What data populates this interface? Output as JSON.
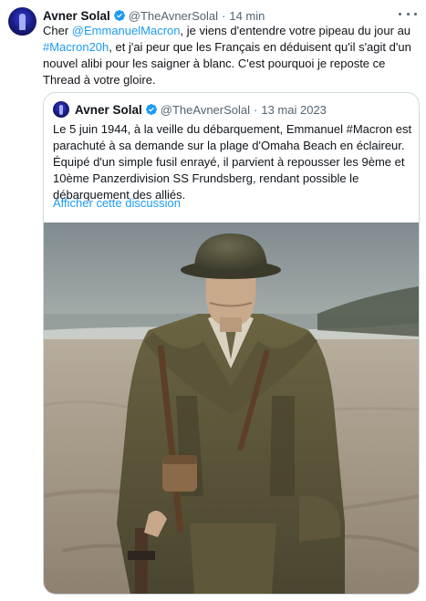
{
  "tweet": {
    "author_name": "Avner Solal",
    "handle": "@TheAvnerSolal",
    "separator": "·",
    "time": "14 min",
    "text_parts": [
      {
        "text": "Cher ",
        "type": "text"
      },
      {
        "text": "@EmmanuelMacron",
        "type": "link"
      },
      {
        "text": ", je viens d'entendre votre pipeau du jour au ",
        "type": "text"
      },
      {
        "text": "#Macron20h",
        "type": "link"
      },
      {
        "text": ", et j'ai peur que les Français en déduisent qu'il s'agit d'un nouvel alibi pour les saigner à blanc. C'est pourquoi je reposte ce Thread à votre gloire.",
        "type": "text"
      }
    ]
  },
  "quoted": {
    "author_name": "Avner Solal",
    "handle": "@TheAvnerSolal",
    "separator": "·",
    "date": "13 mai 2023",
    "text": "Le 5 juin 1944, à la veille du débarquement, Emmanuel #Macron est parachuté à sa demande sur la plage d'Omaha Beach en éclaireur. Équipé d'un simple fusil enrayé, il parvient à repousser les 9ème et 10ème Panzerdivision SS Frundsberg, rendant possible le débarquement des alliés.",
    "show_thread_label": "Afficher cette discussion"
  },
  "colors": {
    "link": "#1d9bf0",
    "verified": "#1d9bf0",
    "secondary_text": "#536471",
    "border": "#cfd9de"
  },
  "icons": {
    "verified": "verified-badge-icon",
    "more": "more-options-icon"
  }
}
